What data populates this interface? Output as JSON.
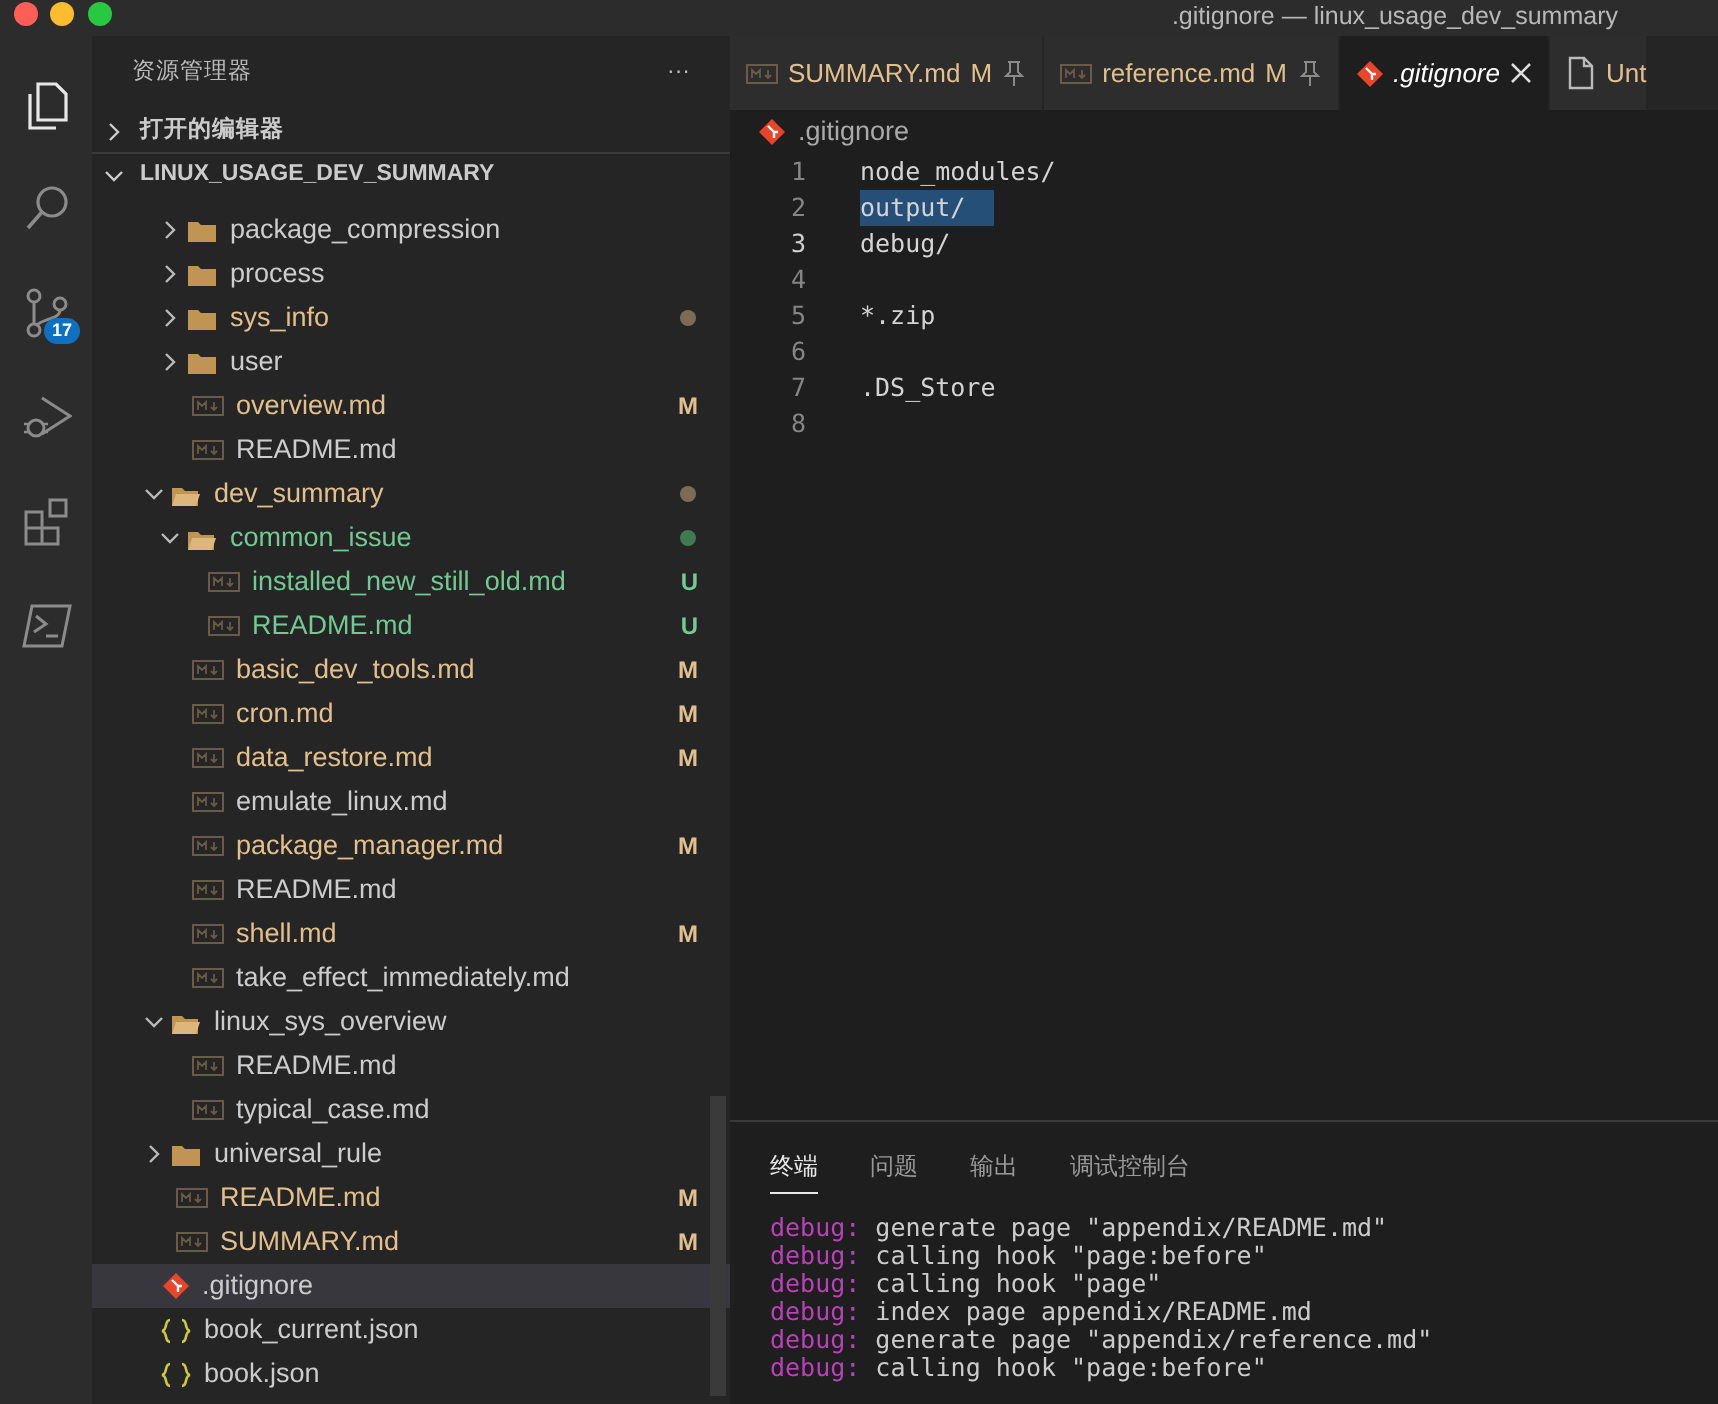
{
  "window": {
    "title": ".gitignore — linux_usage_dev_summary"
  },
  "activity_bar": [
    {
      "kind": "files",
      "selected": true
    },
    {
      "kind": "search",
      "selected": false
    },
    {
      "kind": "source-control",
      "selected": false,
      "badge": "17"
    },
    {
      "kind": "run-debug",
      "selected": false
    },
    {
      "kind": "extensions",
      "selected": false
    },
    {
      "kind": "terminal",
      "selected": false
    }
  ],
  "sidebar": {
    "title": "资源管理器",
    "more": "···",
    "sections": [
      {
        "label": "打开的编辑器",
        "expanded": false
      },
      {
        "label": "LINUX_USAGE_DEV_SUMMARY",
        "expanded": true
      }
    ],
    "tree": [
      {
        "kind": "offscreen",
        "children": [
          {
            "kind": "offscreen",
            "children": [
              {
                "kind": "folder",
                "label": "package_compression",
                "expanded": false,
                "modified": false,
                "untracked": false,
                "selected": false
              },
              {
                "kind": "folder",
                "label": "process",
                "expanded": false,
                "modified": false,
                "untracked": false,
                "selected": false
              },
              {
                "kind": "folder",
                "label": "sys_info",
                "expanded": false,
                "modified": true,
                "untracked": false,
                "selected": false,
                "dot": true,
                "color": "#7d6b58"
              },
              {
                "kind": "folder",
                "label": "user",
                "expanded": false,
                "modified": false,
                "untracked": false,
                "selected": false
              },
              {
                "kind": "md",
                "label": "overview.md",
                "modified": true,
                "untracked": false,
                "selected": false,
                "badge": "M"
              },
              {
                "kind": "md",
                "label": "README.md",
                "modified": false,
                "untracked": false,
                "selected": false
              }
            ]
          },
          {
            "kind": "folder",
            "label": "dev_summary",
            "expanded": true,
            "modified": true,
            "untracked": false,
            "selected": false,
            "dot": true,
            "color": "#7d6b58",
            "children": [
              {
                "kind": "folder",
                "label": "common_issue",
                "expanded": true,
                "modified": false,
                "untracked": true,
                "selected": false,
                "dot": true,
                "color": "#3f7a52",
                "children": [
                  {
                    "kind": "md",
                    "label": "installed_new_still_old.md",
                    "modified": false,
                    "untracked": true,
                    "selected": false,
                    "badge": "U"
                  },
                  {
                    "kind": "md",
                    "label": "README.md",
                    "modified": false,
                    "untracked": true,
                    "selected": false,
                    "badge": "U"
                  }
                ]
              },
              {
                "kind": "md",
                "label": "basic_dev_tools.md",
                "modified": true,
                "untracked": false,
                "selected": false,
                "badge": "M"
              },
              {
                "kind": "md",
                "label": "cron.md",
                "modified": true,
                "untracked": false,
                "selected": false,
                "badge": "M"
              },
              {
                "kind": "md",
                "label": "data_restore.md",
                "modified": true,
                "untracked": false,
                "selected": false,
                "badge": "M"
              },
              {
                "kind": "md",
                "label": "emulate_linux.md",
                "modified": false,
                "untracked": false,
                "selected": false
              },
              {
                "kind": "md",
                "label": "package_manager.md",
                "modified": true,
                "untracked": false,
                "selected": false,
                "badge": "M"
              },
              {
                "kind": "md",
                "label": "README.md",
                "modified": false,
                "untracked": false,
                "selected": false
              },
              {
                "kind": "md",
                "label": "shell.md",
                "modified": true,
                "untracked": false,
                "selected": false,
                "badge": "M"
              },
              {
                "kind": "md",
                "label": "take_effect_immediately.md",
                "modified": false,
                "untracked": false,
                "selected": false
              }
            ]
          },
          {
            "kind": "folder",
            "label": "linux_sys_overview",
            "expanded": true,
            "modified": false,
            "untracked": false,
            "selected": false,
            "children": [
              {
                "kind": "md",
                "label": "README.md",
                "modified": false,
                "untracked": false,
                "selected": false
              },
              {
                "kind": "md",
                "label": "typical_case.md",
                "modified": false,
                "untracked": false,
                "selected": false
              }
            ]
          },
          {
            "kind": "folder",
            "label": "universal_rule",
            "expanded": false,
            "modified": false,
            "untracked": false,
            "selected": false
          },
          {
            "kind": "md",
            "label": "README.md",
            "modified": true,
            "untracked": false,
            "selected": false,
            "badge": "M"
          },
          {
            "kind": "md",
            "label": "SUMMARY.md",
            "modified": true,
            "untracked": false,
            "selected": false,
            "badge": "M"
          }
        ]
      },
      {
        "kind": "git",
        "label": ".gitignore",
        "modified": false,
        "untracked": false,
        "selected": true
      },
      {
        "kind": "json",
        "label": "book_current.json",
        "modified": false,
        "untracked": false,
        "selected": false
      },
      {
        "kind": "json",
        "label": "book.json",
        "modified": false,
        "untracked": false,
        "selected": false
      }
    ]
  },
  "tabs": [
    {
      "kind": "md",
      "label": "SUMMARY.md",
      "badge": "M",
      "pinned": true,
      "selected": false,
      "preview": false
    },
    {
      "kind": "md",
      "label": "reference.md",
      "badge": "M",
      "pinned": true,
      "selected": false,
      "preview": false
    },
    {
      "kind": "git",
      "label": ".gitignore",
      "pinned": false,
      "selected": true,
      "preview": true
    },
    {
      "kind": "file",
      "label": "Unt",
      "pinned": false,
      "selected": false,
      "preview": false
    }
  ],
  "breadcrumb": {
    "kind": "git",
    "label": ".gitignore"
  },
  "code_lines": [
    {
      "number": "1",
      "text": "node_modules/",
      "current": false,
      "selected": false
    },
    {
      "number": "2",
      "text": "output/",
      "current": false,
      "selected": true
    },
    {
      "number": "3",
      "text": "debug/",
      "current": true,
      "selected": false
    },
    {
      "number": "4",
      "current": false,
      "selected": false
    },
    {
      "number": "5",
      "text": "*.zip",
      "current": false,
      "selected": false
    },
    {
      "number": "6",
      "current": false,
      "selected": false
    },
    {
      "number": "7",
      "text": ".DS_Store",
      "current": false,
      "selected": false
    },
    {
      "number": "8",
      "current": false,
      "selected": false
    }
  ],
  "panel": {
    "tabs": [
      {
        "label": "终端",
        "selected": true
      },
      {
        "label": "问题",
        "selected": false
      },
      {
        "label": "输出",
        "selected": false
      },
      {
        "label": "调试控制台",
        "selected": false
      }
    ],
    "terminal_lines": [
      {
        "prefix": "debug:",
        "text": "generate page \"appendix/README.md\""
      },
      {
        "prefix": "debug:",
        "text": "calling hook \"page:before\""
      },
      {
        "prefix": "debug:",
        "text": "calling hook \"page\""
      },
      {
        "prefix": "debug:",
        "text": "index page appendix/README.md"
      },
      {
        "prefix": "debug:",
        "text": "generate page \"appendix/reference.md\""
      },
      {
        "prefix": "debug:",
        "text": "calling hook \"page:before\""
      }
    ]
  }
}
